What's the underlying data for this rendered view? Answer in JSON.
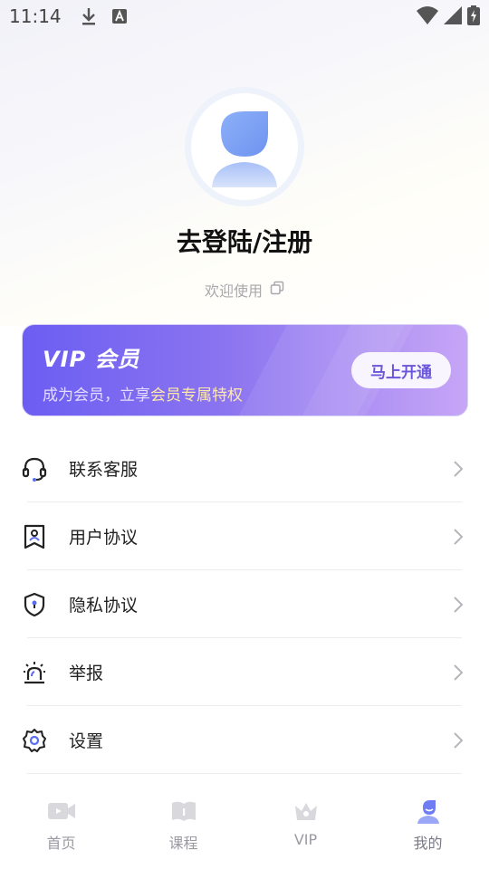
{
  "status_bar": {
    "time": "11:14",
    "icons": [
      "download-icon",
      "text-a-icon",
      "wifi-icon",
      "signal-icon",
      "battery-charging-icon"
    ]
  },
  "profile": {
    "login_title": "去登陆/注册",
    "welcome": "欢迎使用",
    "copy_icon": "copy-icon"
  },
  "vip": {
    "title": "VIP 会员",
    "sub_prefix": "成为会员，立享",
    "sub_highlight": "会员专属特权",
    "button": "马上开通"
  },
  "menu": {
    "items": [
      {
        "label": "联系客服",
        "icon": "headset-icon"
      },
      {
        "label": "用户协议",
        "icon": "user-agreement-icon"
      },
      {
        "label": "隐私协议",
        "icon": "shield-lock-icon"
      },
      {
        "label": "举报",
        "icon": "alarm-siren-icon"
      },
      {
        "label": "设置",
        "icon": "gear-icon"
      }
    ]
  },
  "bottom_nav": {
    "items": [
      {
        "label": "首页",
        "icon": "video-camera-icon"
      },
      {
        "label": "课程",
        "icon": "book-icon"
      },
      {
        "label": "VIP",
        "icon": "crown-icon"
      },
      {
        "label": "我的",
        "icon": "profile-icon"
      }
    ],
    "active": "我的"
  },
  "colors": {
    "vip_gradient_start": "#6c5ef2",
    "vip_gradient_end": "#c7a6f6",
    "vip_button_text": "#6a56d8",
    "vip_highlight": "#ffe9a8",
    "active_nav": "#6f7cf2"
  }
}
